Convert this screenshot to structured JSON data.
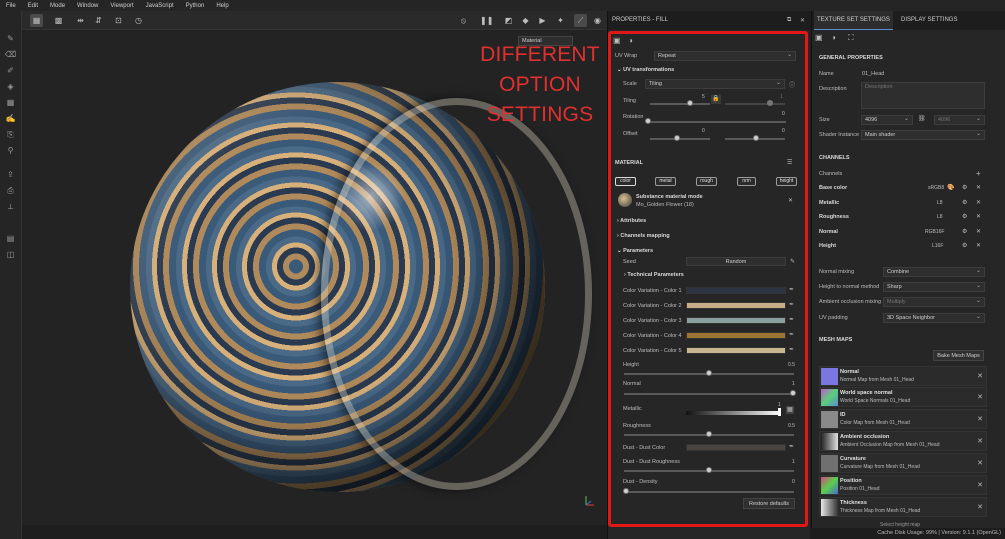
{
  "menu": [
    "File",
    "Edit",
    "Mode",
    "Window",
    "Viewport",
    "JavaScript",
    "Python",
    "Help"
  ],
  "viewport": {
    "material_select": "Material",
    "overlay_line1": "DIFFERENT",
    "overlay_line2": "OPTION",
    "overlay_line3": "SETTINGS"
  },
  "properties": {
    "title": "PROPERTIES - FILL",
    "uv_wrap_label": "UV Wrap",
    "uv_wrap_value": "Repeat",
    "uv_transform_header": "UV transformations",
    "scale_label": "Scale",
    "scale_value": "Tiling",
    "tiling_label": "Tiling",
    "tiling_value": "5",
    "tiling_value2": "1",
    "rotation_label": "Rotation",
    "rotation_value": "0",
    "offset_label": "Offset",
    "offset_value1": "0",
    "offset_value2": "0",
    "material_header": "MATERIAL",
    "channels": [
      {
        "label": "color",
        "active": true
      },
      {
        "label": "metal",
        "active": false
      },
      {
        "label": "rough",
        "active": false
      },
      {
        "label": "nrm",
        "active": false
      },
      {
        "label": "height",
        "active": false
      }
    ],
    "substance_mode": "Substance material mode",
    "substance_name": "Mo_Golden Flower (18)",
    "attributes": "Attributes",
    "channels_mapping": "Channels mapping",
    "parameters": "Parameters",
    "seed_label": "Seed",
    "seed_value": "Random",
    "technical": "Technical Parameters",
    "color_variations": [
      {
        "label": "Color Variation - Color 1",
        "color": "#2b3440"
      },
      {
        "label": "Color Variation - Color 2",
        "color": "#c9ad86"
      },
      {
        "label": "Color Variation - Color 3",
        "color": "#8aa0a0"
      },
      {
        "label": "Color Variation - Color 4",
        "color": "#9a7430"
      },
      {
        "label": "Color Variation - Color 5",
        "color": "#c8b690"
      }
    ],
    "height_label": "Height",
    "height_value": "0.5",
    "normal_label": "Normal",
    "normal_value": "1",
    "metallic_label": "Metallic",
    "metallic_value": "1",
    "roughness_label": "Roughness",
    "roughness_value": "0.5",
    "dust_color_label": "Dust - Dust Color",
    "dust_color": "#4a4440",
    "dust_rough_label": "Dust - Dust Roughness",
    "dust_rough_value": "1",
    "dust_density_label": "Dust - Density",
    "dust_density_value": "0",
    "restore": "Restore defaults"
  },
  "texture_set": {
    "tab1": "TEXTURE SET SETTINGS",
    "tab2": "DISPLAY SETTINGS",
    "general": "GENERAL PROPERTIES",
    "name_label": "Name",
    "name_value": "01_Head",
    "desc_label": "Description",
    "desc_placeholder": "Description",
    "size_label": "Size",
    "size_value": "4096",
    "size_value2": "4096",
    "shader_label": "Shader Instance",
    "shader_value": "Main shader",
    "channels_header": "CHANNELS",
    "channels_label": "Channels",
    "channel_list": [
      {
        "name": "Base color",
        "format": "sRGB8"
      },
      {
        "name": "Metallic",
        "format": "L8"
      },
      {
        "name": "Roughness",
        "format": "L8"
      },
      {
        "name": "Normal",
        "format": "RGB16F"
      },
      {
        "name": "Height",
        "format": "L16F"
      }
    ],
    "normal_mixing_label": "Normal mixing",
    "normal_mixing_value": "Combine",
    "htn_label": "Height to normal method",
    "htn_value": "Sharp",
    "ao_label": "Ambient occlusion mixing",
    "ao_value": "Multiply",
    "uvpad_label": "UV padding",
    "uvpad_value": "3D Space Neighbor",
    "mesh_header": "MESH MAPS",
    "bake": "Bake Mesh Maps",
    "mesh_maps": [
      {
        "title": "Normal",
        "sub": "Normal Map from Mesh 01_Head",
        "color": "#7a78e0"
      },
      {
        "title": "World space normal",
        "sub": "World Space Normals 01_Head",
        "color": "#c05ad0"
      },
      {
        "title": "ID",
        "sub": "Color Map from Mesh 01_Head",
        "color": "#8a8a8a"
      },
      {
        "title": "Ambient occlusion",
        "sub": "Ambient Occlusion Map from Mesh 01_Head",
        "color": "#d8d8d8"
      },
      {
        "title": "Curvature",
        "sub": "Curvature Map from Mesh 01_Head",
        "color": "#707070"
      },
      {
        "title": "Position",
        "sub": "Position 01_Head",
        "color": "#d04a80"
      },
      {
        "title": "Thickness",
        "sub": "Thickness Map from Mesh 01_Head",
        "color": "#e8e8e8"
      }
    ],
    "select_height": "Select height map"
  },
  "status": "Cache Disk Usage:  99% | Version: 9.1.1 (OpenGL)"
}
